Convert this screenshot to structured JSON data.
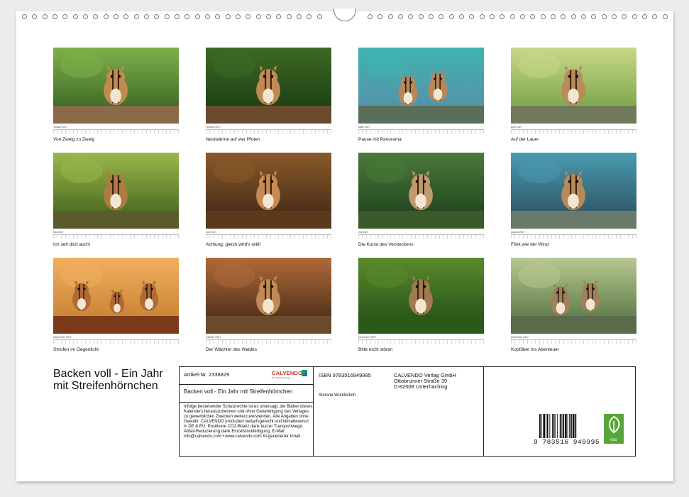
{
  "months": [
    {
      "name": "Januar 2027",
      "caption": "Von Zweig zu Zweig"
    },
    {
      "name": "Februar 2027",
      "caption": "Nestwärme auf vier Pfoten"
    },
    {
      "name": "März 2027",
      "caption": "Pause mit Panorama"
    },
    {
      "name": "April 2027",
      "caption": "Auf der Lauer"
    },
    {
      "name": "Mai 2027",
      "caption": "Ich seh dich auch!"
    },
    {
      "name": "Juni 2027",
      "caption": "Achtung, gleich wird's wild!"
    },
    {
      "name": "Juli 2027",
      "caption": "Die Kunst des Versteckens"
    },
    {
      "name": "August 2027",
      "caption": "Flink wie der Wind"
    },
    {
      "name": "September 2027",
      "caption": "Streifen im Gegenlicht"
    },
    {
      "name": "Oktober 2027",
      "caption": "Der Wächter des Waldes"
    },
    {
      "name": "November 2027",
      "caption": "Bitte nicht stören"
    },
    {
      "name": "Dezember 2027",
      "caption": "Kopfüber ins Abenteuer"
    }
  ],
  "title": "Backen voll - Ein Jahr mit Streifenhörnchen",
  "info": {
    "article": "Artikel-Nr. 2336829",
    "brand": "CALVENDO",
    "brand_sub": "Der Kalenderverlag",
    "subtitle": "Backen voll - Ein Jahr mit Streifenhörnchen",
    "legal": "Infolge bestehender Schutzrechte ist es untersagt, die Blätter dieses Kalenders herauszutrennen und ohne Genehmigung des Verlages zu gewerblichen Zwecken weiterzuverwenden. Alle Angaben ohne Gewähr. CALVENDO produziert bedarfsgerecht und klimabewusst in DE & EU. Positivere CO2-Bilanz dank kurzer Transportwege. Abfall-Reduzierung dank Einzelstückfertigung. E-Mail: info@calvendo.com • www.calvendo.com KI-generierter Inhalt",
    "isbn": "ISBN 9783516949995",
    "author": "Simone Wunderlich",
    "publisher_line1": "CALVENDO Verlag GmbH",
    "publisher_line2": "Ottobrunner Straße 39",
    "publisher_line3": "D-82008 Unterhaching",
    "barcode_number": "9 783516 949995",
    "eco_label": "eco"
  }
}
